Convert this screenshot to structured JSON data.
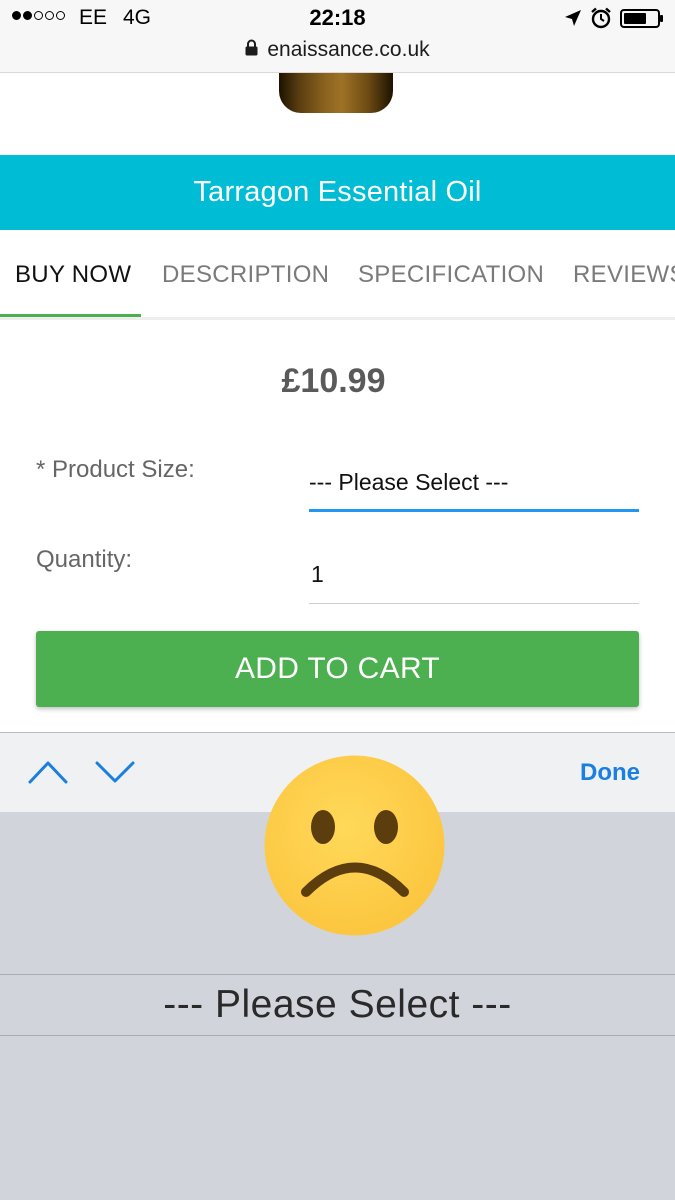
{
  "status_bar": {
    "carrier": "EE",
    "network": "4G",
    "time": "22:18",
    "signal_bars_filled": 2,
    "signal_bars_total": 5,
    "url": "enaissance.co.uk",
    "icons": [
      "lock-icon",
      "location-arrow-icon",
      "alarm-icon",
      "battery-icon"
    ]
  },
  "product": {
    "title": "Tarragon Essential Oil",
    "price": "£10.99"
  },
  "tabs": {
    "buy_now": "BUY NOW",
    "description": "DESCRIPTION",
    "specification": "SPECIFICATION",
    "reviews": "REVIEWS",
    "active": "BUY NOW"
  },
  "form": {
    "size_label": "* Product Size:",
    "size_value": "--- Please Select ---",
    "quantity_label": "Quantity:",
    "quantity_value": "1",
    "add_to_cart": "ADD TO CART"
  },
  "keyboard_toolbar": {
    "done": "Done",
    "icons": [
      "chevron-up-icon",
      "chevron-down-icon"
    ]
  },
  "picker": {
    "selected_option": "--- Please Select ---"
  },
  "overlay": {
    "emoji": "sad-face-emoji"
  },
  "colors": {
    "title_bar": "#00bcd4",
    "tab_indicator": "#4caf50",
    "add_to_cart": "#4caf50",
    "select_underline": "#2196f3",
    "done": "#1a7fe0",
    "picker_background": "#d1d4da",
    "emoji_face": "#fccb4a"
  }
}
